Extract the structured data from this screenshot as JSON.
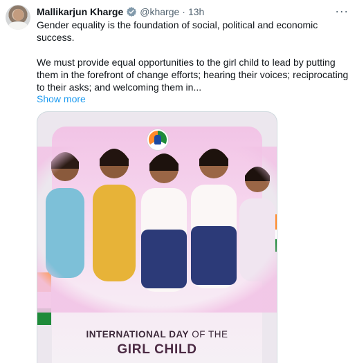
{
  "tweet": {
    "author_name": "Mallikarjun Kharge",
    "handle": "@kharge",
    "separator": "·",
    "time": "13h",
    "more_icon": "···",
    "text": "Gender equality is the foundation of social, political and economic success.\n\nWe must provide equal opportunities to the girl child to lead by putting them in the forefront of change efforts; hearing their voices; reciprocating to their asks; and welcoming them in...",
    "show_more": "Show more"
  },
  "media": {
    "headline_bold": "INTERNATIONAL DAY",
    "headline_light": " OF THE",
    "headline_sub": "GIRL CHILD"
  },
  "colors": {
    "link": "#1d9bf0",
    "verified": "#829aab",
    "saffron": "#ff8a2a",
    "green": "#1f8b3a"
  }
}
